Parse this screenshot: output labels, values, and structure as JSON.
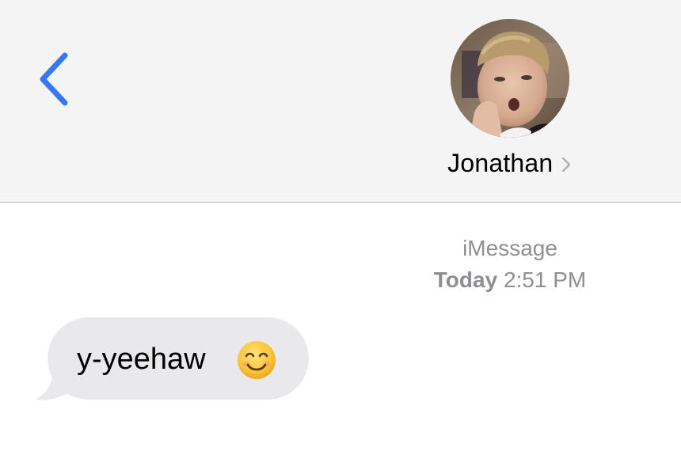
{
  "header": {
    "back_icon": "chevron-left-icon",
    "contact": {
      "name": "Jonathan",
      "disclosure_icon": "chevron-right-icon",
      "avatar": "contact-photo"
    }
  },
  "conversation": {
    "service_label": "iMessage",
    "timestamp_day": "Today",
    "timestamp_time": "2:51 PM",
    "messages": [
      {
        "direction": "incoming",
        "text": "y-yeehaw",
        "emoji_icon": "smiling-face-emoji-icon"
      }
    ]
  },
  "colors": {
    "accent": "#3478f6",
    "header_bg": "#f4f4f4",
    "incoming_bubble": "#e9e9eb",
    "meta_text": "#8e8e93"
  }
}
